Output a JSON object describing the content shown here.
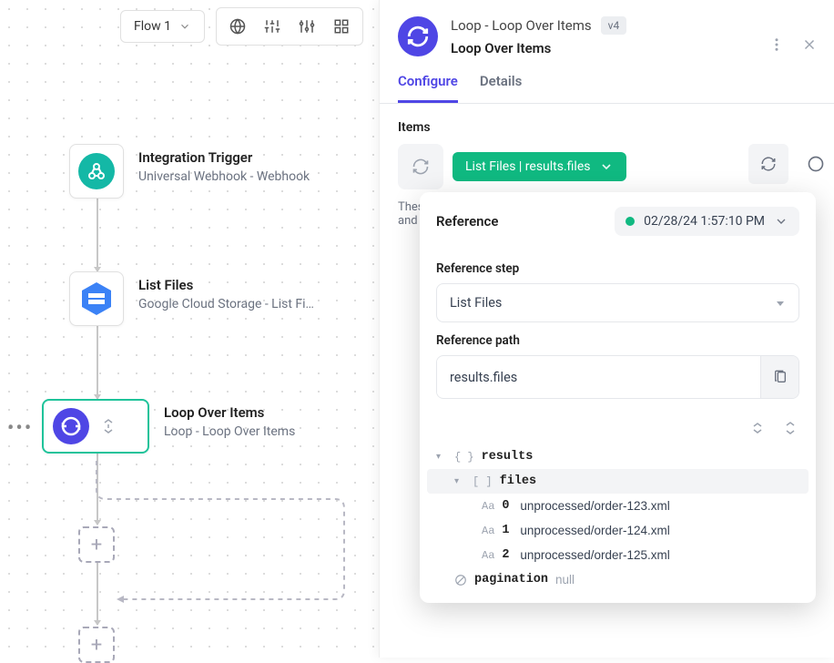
{
  "toolbar": {
    "flow_name": "Flow 1"
  },
  "nodes": {
    "trigger": {
      "title": "Integration Trigger",
      "subtitle": "Universal Webhook - Webhook"
    },
    "list_files": {
      "title": "List Files",
      "subtitle": "Google Cloud Storage - List Fi…"
    },
    "loop": {
      "title": "Loop Over Items",
      "subtitle": "Loop - Loop Over Items"
    }
  },
  "panel": {
    "title": "Loop - Loop Over Items",
    "version": "v4",
    "subtitle": "Loop Over Items",
    "tabs": {
      "configure": "Configure",
      "details": "Details"
    },
    "items_label": "Items",
    "pill_text": "List Files | results.files",
    "help": "These and s"
  },
  "reference": {
    "header": "Reference",
    "timestamp": "02/28/24 1:57:10 PM",
    "step_label": "Reference step",
    "step_value": "List Files",
    "path_label": "Reference path",
    "path_value": "results.files",
    "tree": {
      "results_key": "results",
      "files_key": "files",
      "files": [
        {
          "idx": "0",
          "val": "unprocessed/order-123.xml"
        },
        {
          "idx": "1",
          "val": "unprocessed/order-124.xml"
        },
        {
          "idx": "2",
          "val": "unprocessed/order-125.xml"
        }
      ],
      "pagination_key": "pagination",
      "pagination_val": "null"
    }
  }
}
